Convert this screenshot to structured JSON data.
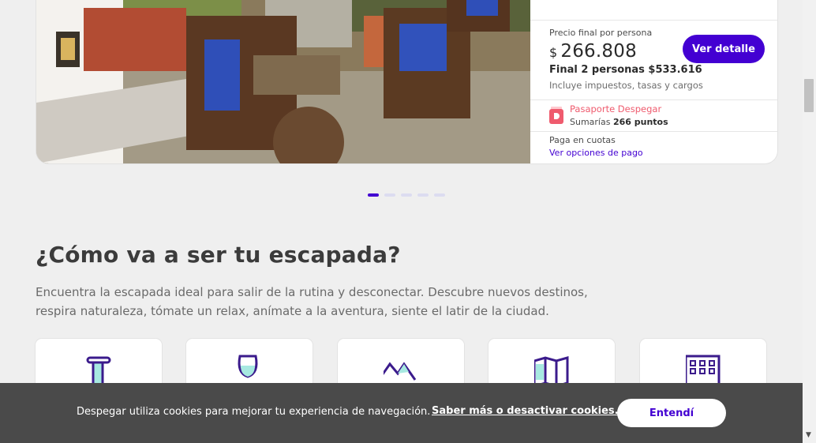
{
  "offer": {
    "price_label": "Precio final por persona",
    "currency": "$",
    "price": "266.808",
    "final_two": "Final 2 personas $533.616",
    "taxes_note": "Incluye impuestos, tasas y cargos",
    "detail_button": "Ver detalle",
    "passport_title": "Pasaporte Despegar",
    "passport_prefix": "Sumarías",
    "passport_points": "266 puntos",
    "installments_label": "Paga en cuotas",
    "installments_link": "Ver opciones de pago"
  },
  "carousel": {
    "count": 5,
    "active": 0
  },
  "section": {
    "title": "¿Cómo va a ser tu escapada?",
    "description_line1": "Encuentra la escapada ideal para salir de la rutina y desconectar. Descubre nuevos destinos,",
    "description_line2": "respira naturaleza, tómate un relax, anímate a la aventura, siente el latir de la ciudad."
  },
  "categories": [
    {
      "icon": "column-icon"
    },
    {
      "icon": "wine-glass-icon"
    },
    {
      "icon": "mountains-icon"
    },
    {
      "icon": "map-icon"
    },
    {
      "icon": "building-icon"
    }
  ],
  "cookie_banner": {
    "text": "Despegar utiliza cookies para mejorar tu experiencia de navegación.",
    "link": "Saber más o desactivar cookies.",
    "button": "Entendí"
  },
  "colors": {
    "brand": "#4300d2",
    "passport": "#ef5b6e",
    "icon_fill": "#a7e9e1"
  }
}
